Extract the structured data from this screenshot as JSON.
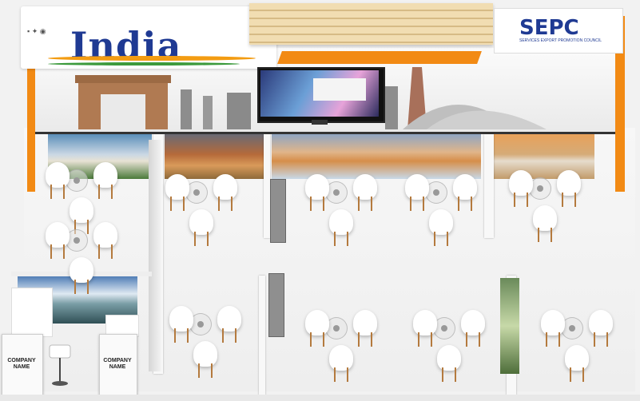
{
  "header": {
    "country_title": "India",
    "org_name": "SEPC",
    "org_subtitle": "SERVICES EXPORT PROMOTION COUNCIL"
  },
  "booths": {
    "company_label_left": "COMPANY NAME",
    "company_label_right": "COMPANY NAME"
  },
  "colors": {
    "accent_orange": "#f28a14",
    "title_blue": "#1f3a93"
  }
}
